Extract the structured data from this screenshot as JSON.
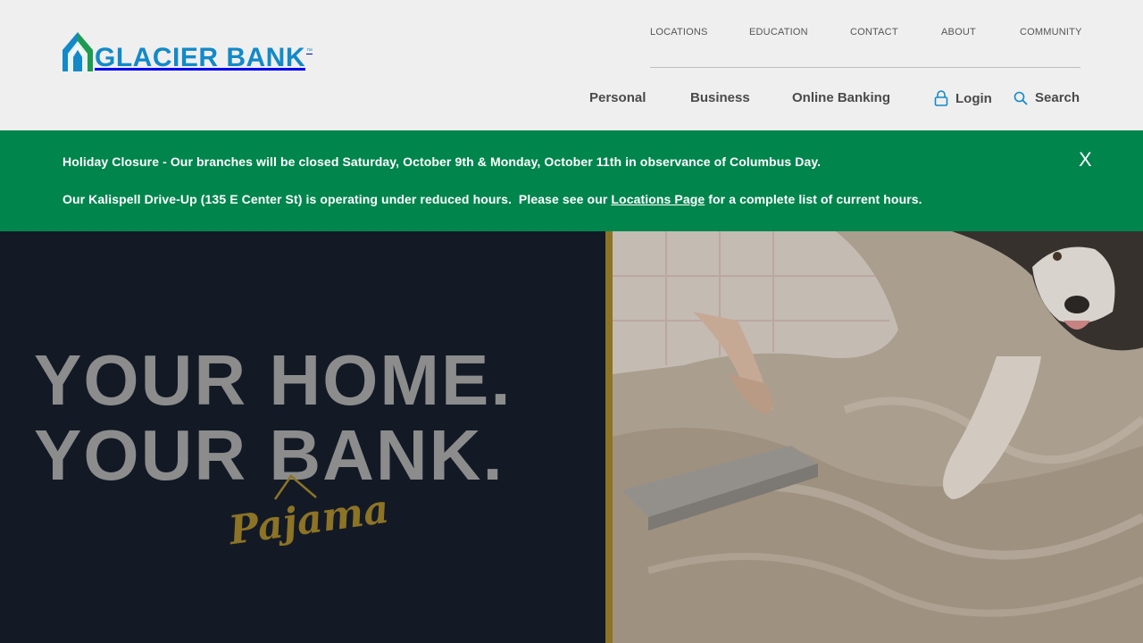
{
  "header": {
    "logo_text": "GLACIER BANK",
    "logo_tm": "™",
    "utility_nav": [
      "LOCATIONS",
      "EDUCATION",
      "CONTACT",
      "ABOUT",
      "COMMUNITY"
    ],
    "main_nav": {
      "personal": "Personal",
      "business": "Business",
      "online_banking": "Online Banking",
      "login": "Login",
      "search": "Search"
    },
    "icons": {
      "login": "lock-icon",
      "search": "search-icon",
      "logo": "glacier-mountain-logo"
    }
  },
  "alert": {
    "line1": "Holiday Closure - Our branches will be closed Saturday, October 9th & Monday, October 11th in observance of Columbus Day.",
    "line2_before": "Our Kalispell Drive-Up (135 E Center St) is operating under reduced hours.  Please see our ",
    "line2_link": "Locations Page",
    "line2_after": " for a complete list of current hours.",
    "close_label": "X"
  },
  "hero": {
    "headline_line1": "YOUR HOME.",
    "headline_line2": "YOUR BANK.",
    "script_text": "Pajama"
  },
  "colors": {
    "brand_blue": "#1389c8",
    "brand_green": "#00854d",
    "alert_bg": "#00854d",
    "hero_dark": "#131a26",
    "gold": "#8c7325"
  }
}
